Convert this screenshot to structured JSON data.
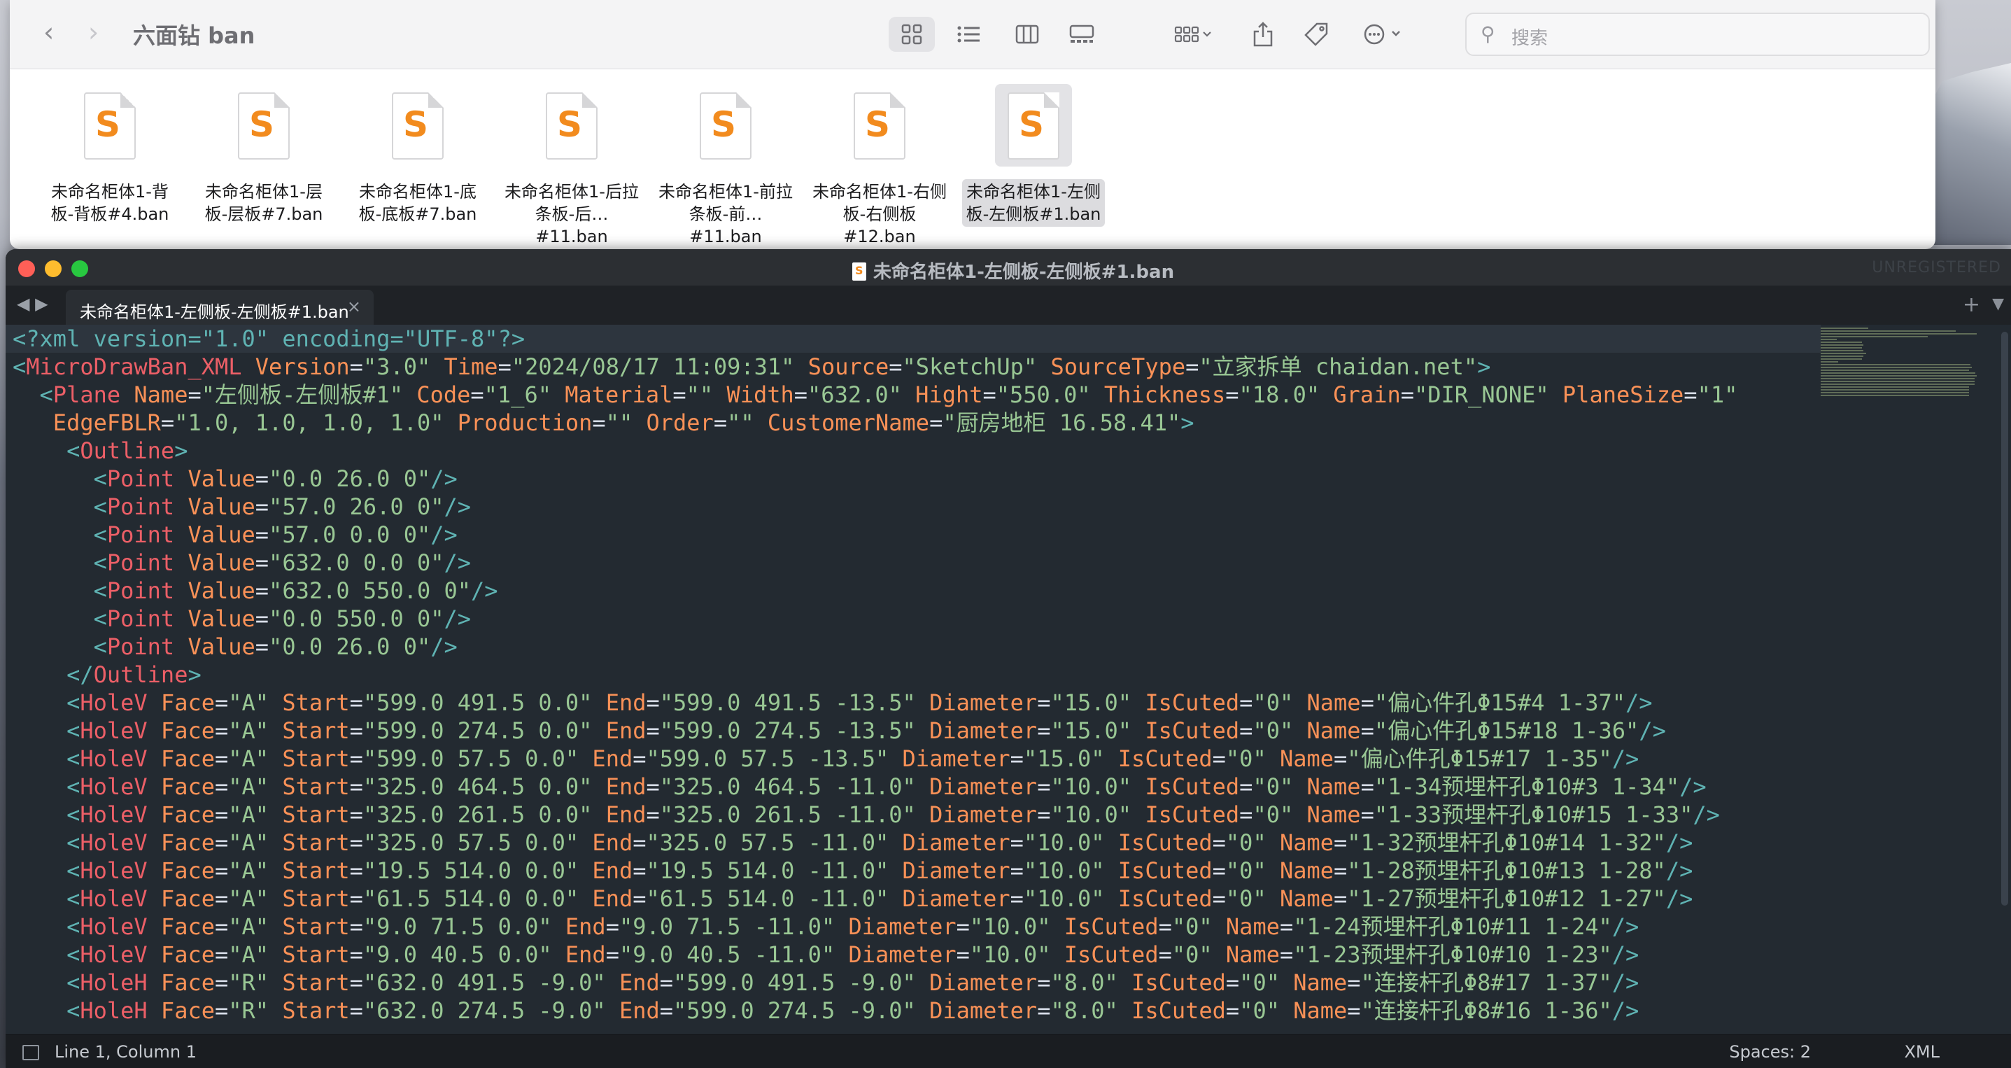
{
  "finder": {
    "title": "六面钻 ban",
    "search_placeholder": "搜索",
    "files": [
      {
        "line1": "未命名柜体1-背",
        "line2": "板-背板#4.ban"
      },
      {
        "line1": "未命名柜体1-层",
        "line2": "板-层板#7.ban"
      },
      {
        "line1": "未命名柜体1-底",
        "line2": "板-底板#7.ban"
      },
      {
        "line1": "未命名柜体1-后拉",
        "line2": "条板-后…#11.ban"
      },
      {
        "line1": "未命名柜体1-前拉",
        "line2": "条板-前…#11.ban"
      },
      {
        "line1": "未命名柜体1-右侧",
        "line2": "板-右侧板#12.ban"
      },
      {
        "line1": "未命名柜体1-左侧",
        "line2": "板-左侧板#1.ban"
      }
    ]
  },
  "editor": {
    "window_title": "未命名柜体1-左侧板-左侧板#1.ban",
    "unregistered": "UNREGISTERED",
    "tab_label": "未命名柜体1-左侧板-左侧板#1.ban",
    "status_position": "Line 1, Column 1",
    "status_spaces": "Spaces: 2",
    "status_syntax": "XML",
    "lines": [
      "<?xml version=\"1.0\" encoding=\"UTF-8\"?>",
      "<MicroDrawBan_XML Version=\"3.0\" Time=\"2024/08/17 11:09:31\" Source=\"SketchUp\" SourceType=\"立家拆单 chaidan.net\">",
      "  <Plane Name=\"左侧板-左侧板#1\" Code=\"1_6\" Material=\"\" Width=\"632.0\" Hight=\"550.0\" Thickness=\"18.0\" Grain=\"DIR_NONE\" PlaneSize=\"1\"",
      "   EdgeFBLR=\"1.0, 1.0, 1.0, 1.0\" Production=\"\" Order=\"\" CustomerName=\"厨房地柜 16.58.41\">",
      "    <Outline>",
      "      <Point Value=\"0.0 26.0 0\"/>",
      "      <Point Value=\"57.0 26.0 0\"/>",
      "      <Point Value=\"57.0 0.0 0\"/>",
      "      <Point Value=\"632.0 0.0 0\"/>",
      "      <Point Value=\"632.0 550.0 0\"/>",
      "      <Point Value=\"0.0 550.0 0\"/>",
      "      <Point Value=\"0.0 26.0 0\"/>",
      "    </Outline>",
      "    <HoleV Face=\"A\" Start=\"599.0 491.5 0.0\" End=\"599.0 491.5 -13.5\" Diameter=\"15.0\" IsCuted=\"0\" Name=\"偏心件孔Φ15#4 1-37\"/>",
      "    <HoleV Face=\"A\" Start=\"599.0 274.5 0.0\" End=\"599.0 274.5 -13.5\" Diameter=\"15.0\" IsCuted=\"0\" Name=\"偏心件孔Φ15#18 1-36\"/>",
      "    <HoleV Face=\"A\" Start=\"599.0 57.5 0.0\" End=\"599.0 57.5 -13.5\" Diameter=\"15.0\" IsCuted=\"0\" Name=\"偏心件孔Φ15#17 1-35\"/>",
      "    <HoleV Face=\"A\" Start=\"325.0 464.5 0.0\" End=\"325.0 464.5 -11.0\" Diameter=\"10.0\" IsCuted=\"0\" Name=\"1-34预埋杆孔Φ10#3 1-34\"/>",
      "    <HoleV Face=\"A\" Start=\"325.0 261.5 0.0\" End=\"325.0 261.5 -11.0\" Diameter=\"10.0\" IsCuted=\"0\" Name=\"1-33预埋杆孔Φ10#15 1-33\"/>",
      "    <HoleV Face=\"A\" Start=\"325.0 57.5 0.0\" End=\"325.0 57.5 -11.0\" Diameter=\"10.0\" IsCuted=\"0\" Name=\"1-32预埋杆孔Φ10#14 1-32\"/>",
      "    <HoleV Face=\"A\" Start=\"19.5 514.0 0.0\" End=\"19.5 514.0 -11.0\" Diameter=\"10.0\" IsCuted=\"0\" Name=\"1-28预埋杆孔Φ10#13 1-28\"/>",
      "    <HoleV Face=\"A\" Start=\"61.5 514.0 0.0\" End=\"61.5 514.0 -11.0\" Diameter=\"10.0\" IsCuted=\"0\" Name=\"1-27预埋杆孔Φ10#12 1-27\"/>",
      "    <HoleV Face=\"A\" Start=\"9.0 71.5 0.0\" End=\"9.0 71.5 -11.0\" Diameter=\"10.0\" IsCuted=\"0\" Name=\"1-24预埋杆孔Φ10#11 1-24\"/>",
      "    <HoleV Face=\"A\" Start=\"9.0 40.5 0.0\" End=\"9.0 40.5 -11.0\" Diameter=\"10.0\" IsCuted=\"0\" Name=\"1-23预埋杆孔Φ10#10 1-23\"/>",
      "    <HoleH Face=\"R\" Start=\"632.0 491.5 -9.0\" End=\"599.0 491.5 -9.0\" Diameter=\"8.0\" IsCuted=\"0\" Name=\"连接杆孔Φ8#17 1-37\"/>",
      "    <HoleH Face=\"R\" Start=\"632.0 274.5 -9.0\" End=\"599.0 274.5 -9.0\" Diameter=\"8.0\" IsCuted=\"0\" Name=\"连接杆孔Φ8#16 1-36\"/>"
    ]
  }
}
